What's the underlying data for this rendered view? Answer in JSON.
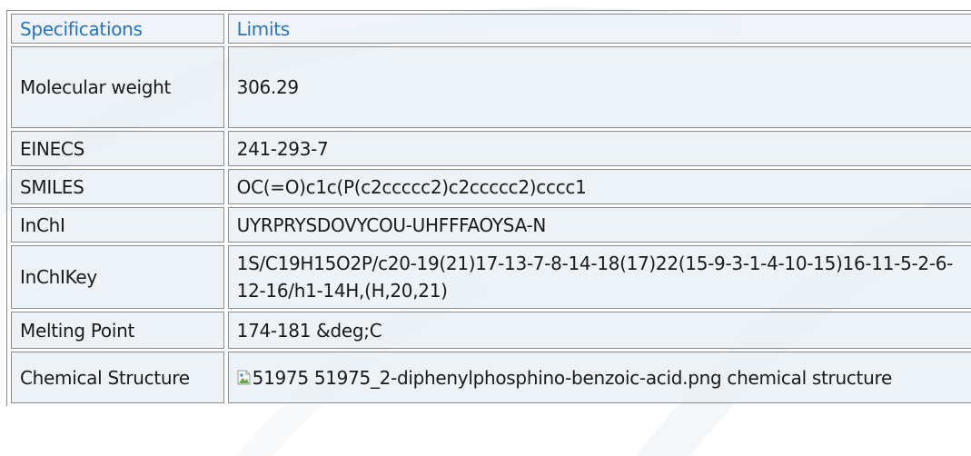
{
  "table": {
    "header": {
      "spec": "Specifications",
      "limits": "Limits"
    },
    "rows": [
      {
        "key": "Molecular weight",
        "value": "306.29"
      },
      {
        "key": "EINECS",
        "value": "241-293-7"
      },
      {
        "key": "SMILES",
        "value": "OC(=O)c1c(P(c2ccccc2)c2ccccc2)cccc1"
      },
      {
        "key": "InChI",
        "value": "UYRPRYSDOVYCOU-UHFFFAOYSA-N"
      },
      {
        "key": "InChIKey",
        "value": "1S/C19H15O2P/c20-19(21)17-13-7-8-14-18(17)22(15-9-3-1-4-10-15)16-11-5-2-6-12-16/h1-14H,(H,20,21)"
      },
      {
        "key": "Melting Point",
        "value": "174-181 &deg;C"
      },
      {
        "key": "Chemical Structure",
        "value": "51975 51975_2-diphenylphosphino-benzoic-acid.png chemical structure"
      }
    ]
  },
  "colors": {
    "header_text": "#2a73b8",
    "cell_bg": "#e8eef4",
    "border": "#8c8c8c"
  }
}
